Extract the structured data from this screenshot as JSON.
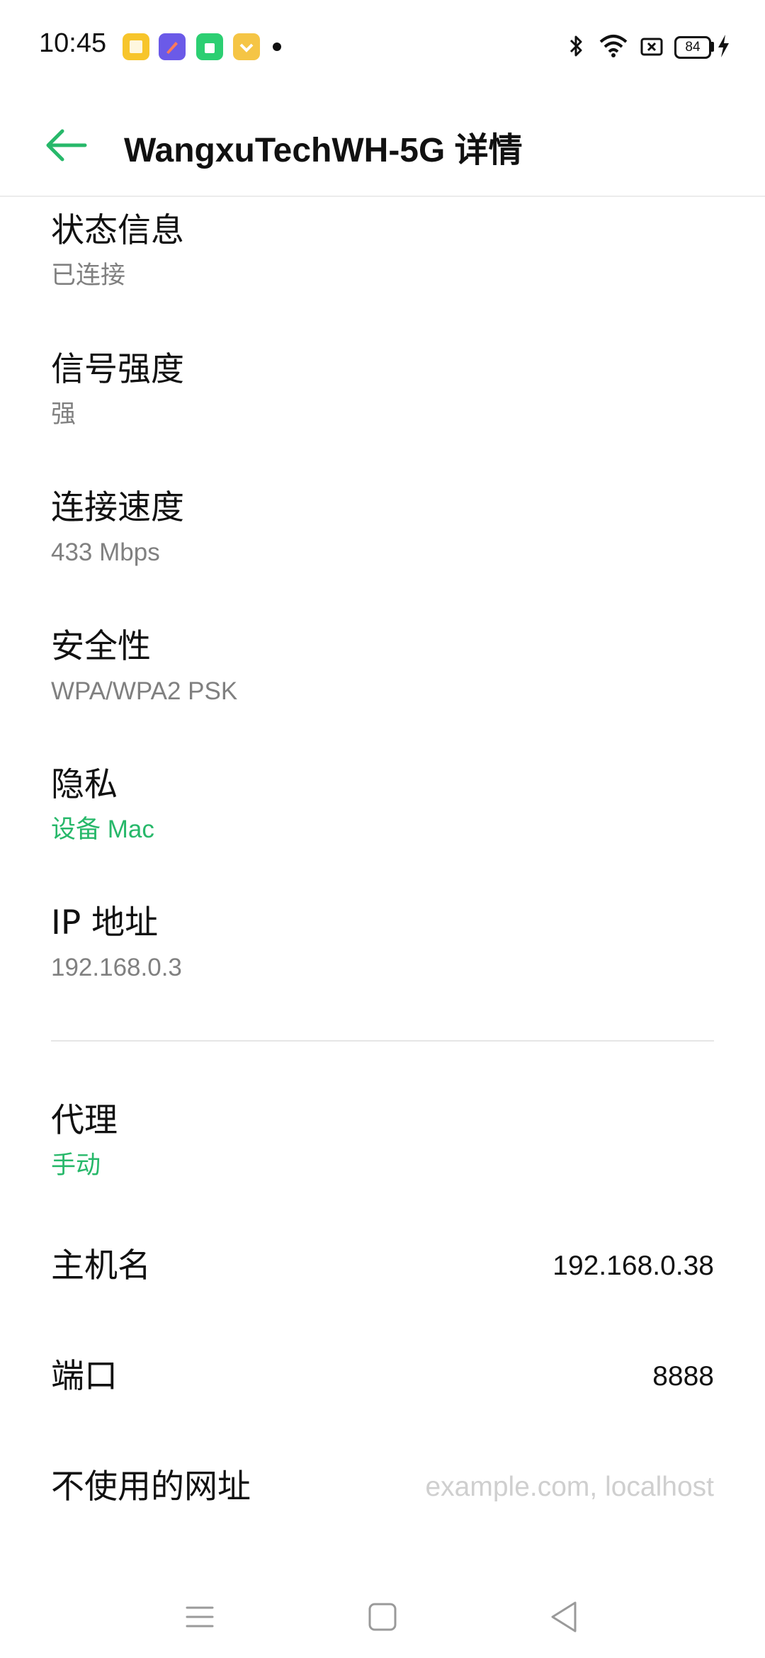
{
  "status_bar": {
    "time": "10:45",
    "battery": "84",
    "icons": [
      "bluetooth-icon",
      "wifi-icon",
      "screen-record-icon",
      "battery-icon",
      "charging-icon"
    ],
    "notification_icons": [
      "notes-app-icon",
      "pen-app-icon",
      "shop-app-icon",
      "gift-app-icon"
    ]
  },
  "header": {
    "title": "WangxuTechWH-5G 详情",
    "back_icon": "back-arrow-icon"
  },
  "details": {
    "status": {
      "label": "状态信息",
      "value": "已连接"
    },
    "signal": {
      "label": "信号强度",
      "value": "强"
    },
    "speed": {
      "label": "连接速度",
      "value": "433 Mbps"
    },
    "security": {
      "label": "安全性",
      "value": "WPA/WPA2 PSK"
    },
    "privacy": {
      "label": "隐私",
      "value": "设备 Mac"
    },
    "ip": {
      "label": "IP 地址",
      "value": "192.168.0.3"
    }
  },
  "proxy": {
    "mode": {
      "label": "代理",
      "value": "手动"
    },
    "hostname": {
      "label": "主机名",
      "value": "192.168.0.38"
    },
    "port": {
      "label": "端口",
      "value": "8888"
    },
    "bypass": {
      "label": "不使用的网址",
      "placeholder": "example.com, localhost"
    }
  },
  "colors": {
    "accent": "#27b86a",
    "secondary_text": "#808080",
    "primary_text": "#111111"
  },
  "nav_bar": {
    "icons": [
      "menu-icon",
      "home-icon",
      "back-icon"
    ]
  }
}
